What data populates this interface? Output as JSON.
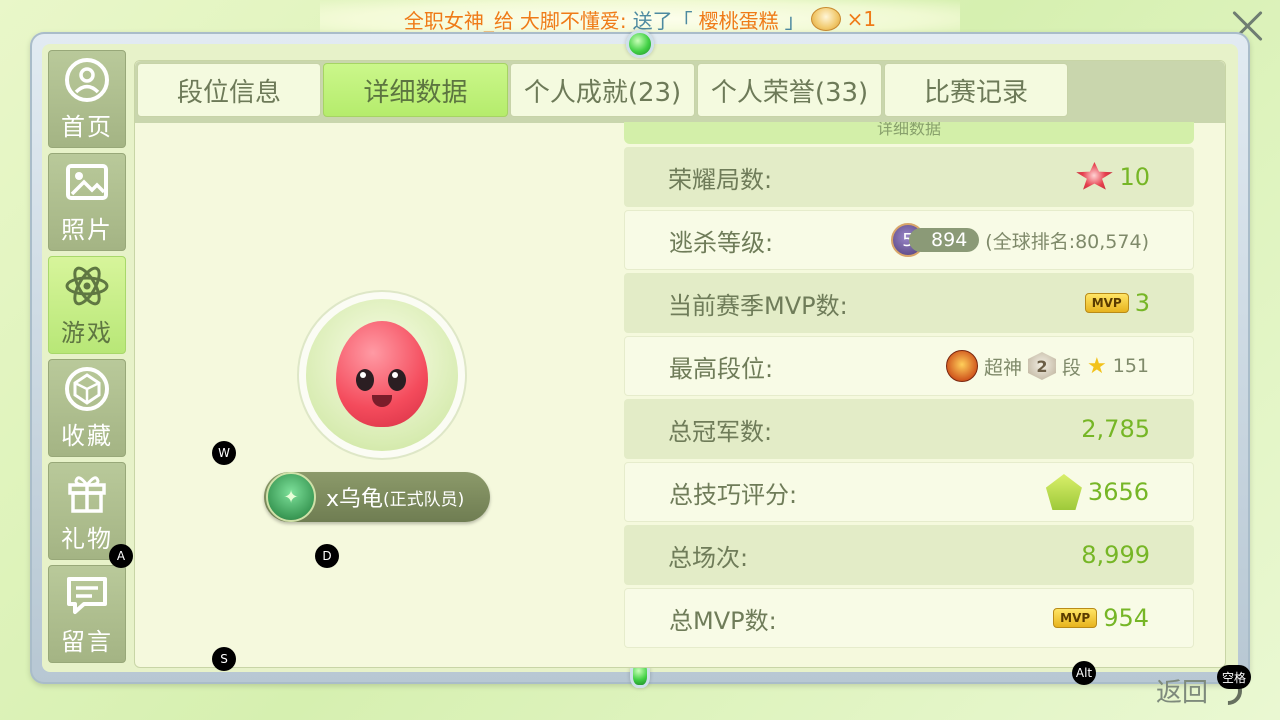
{
  "notification": {
    "part1": "全职女神_给",
    "part2": "大脚不懂爱:",
    "part3": "送了「",
    "gift_name": "樱桃蛋糕",
    "part4": "」",
    "count": "×1"
  },
  "sidebar": {
    "items": [
      {
        "label": "首页",
        "icon": "person-icon",
        "active": false
      },
      {
        "label": "照片",
        "icon": "photo-icon",
        "active": false
      },
      {
        "label": "游戏",
        "icon": "atom-icon",
        "active": true
      },
      {
        "label": "收藏",
        "icon": "gem-icon",
        "active": false
      },
      {
        "label": "礼物",
        "icon": "gift-icon",
        "active": false
      },
      {
        "label": "留言",
        "icon": "message-icon",
        "active": false
      }
    ]
  },
  "tabs": [
    {
      "label": "段位信息",
      "active": false
    },
    {
      "label": "详细数据",
      "active": true
    },
    {
      "label": "个人成就(23)",
      "active": false
    },
    {
      "label": "个人荣誉(33)",
      "active": false
    },
    {
      "label": "比赛记录",
      "active": false
    }
  ],
  "profile": {
    "team_name": "x乌龟",
    "team_role": "(正式队员)"
  },
  "details": {
    "header": "详细数据",
    "rows": [
      {
        "label": "荣耀局数:",
        "value": "10"
      },
      {
        "label": "逃杀等级:",
        "level": "5",
        "points": "894",
        "rank_text": "(全球排名:80,574)"
      },
      {
        "label": "当前赛季MVP数:",
        "badge": "MVP",
        "value": "3"
      },
      {
        "label": "最高段位:",
        "rank_name": "超神",
        "segment": "2",
        "segment_suffix": "段",
        "stars": "151"
      },
      {
        "label": "总冠军数:",
        "value": "2,785"
      },
      {
        "label": "总技巧评分:",
        "value": "3656"
      },
      {
        "label": "总场次:",
        "value": "8,999"
      },
      {
        "label": "总MVP数:",
        "badge": "MVP",
        "value": "954"
      }
    ]
  },
  "keys": {
    "w": "W",
    "a": "A",
    "s": "S",
    "d": "D",
    "alt": "Alt",
    "space": "空格"
  },
  "back_label": "返回",
  "colors": {
    "accent_green": "#76b626",
    "active_tab": "#b5ec6c",
    "notify_orange": "#ef7b18"
  }
}
